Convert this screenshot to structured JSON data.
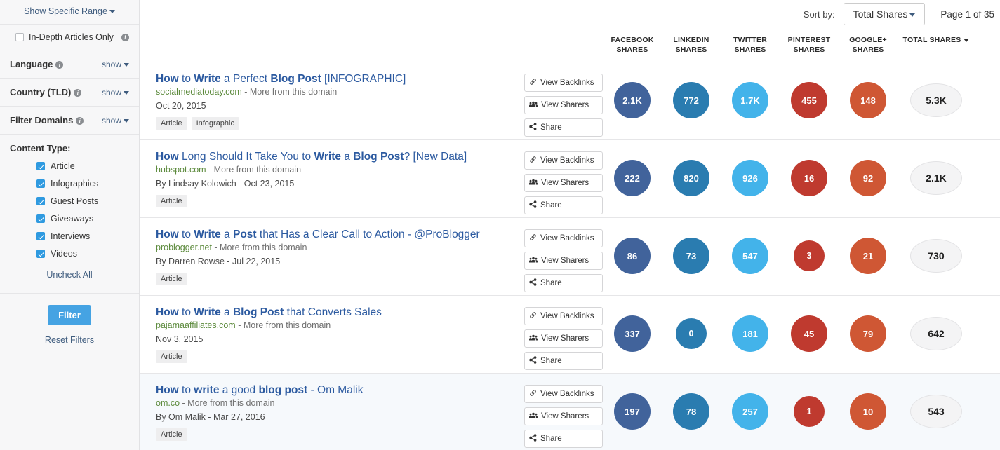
{
  "sidebar": {
    "show_specific_range": "Show Specific Range",
    "in_depth": {
      "label": "In-Depth Articles Only",
      "checked": false
    },
    "sections": [
      {
        "title": "Language",
        "show": "show"
      },
      {
        "title": "Country (TLD)",
        "show": "show"
      },
      {
        "title": "Filter Domains",
        "show": "show"
      }
    ],
    "content_type": {
      "title": "Content Type:",
      "items": [
        {
          "label": "Article",
          "checked": true
        },
        {
          "label": "Infographics",
          "checked": true
        },
        {
          "label": "Guest Posts",
          "checked": true
        },
        {
          "label": "Giveaways",
          "checked": true
        },
        {
          "label": "Interviews",
          "checked": true
        },
        {
          "label": "Videos",
          "checked": true
        }
      ],
      "uncheck_all": "Uncheck All"
    },
    "filter_button": "Filter",
    "reset_filters": "Reset Filters"
  },
  "toolbar": {
    "sort_by_label": "Sort by:",
    "sort_value": "Total Shares",
    "page_status": "Page 1 of 35"
  },
  "columns": [
    {
      "line1": "FACEBOOK",
      "line2": "SHARES",
      "key": "facebook"
    },
    {
      "line1": "LINKEDIN",
      "line2": "SHARES",
      "key": "linkedin"
    },
    {
      "line1": "TWITTER",
      "line2": "SHARES",
      "key": "twitter"
    },
    {
      "line1": "PINTEREST",
      "line2": "SHARES",
      "key": "pinterest"
    },
    {
      "line1": "GOOGLE+",
      "line2": "SHARES",
      "key": "googleplus"
    },
    {
      "line1": "TOTAL SHARES",
      "line2": "",
      "key": "total",
      "sorted": true
    }
  ],
  "row_buttons": [
    {
      "label": "View Backlinks",
      "icon": "link-icon"
    },
    {
      "label": "View Sharers",
      "icon": "people-icon"
    },
    {
      "label": "Share",
      "icon": "share-icon"
    }
  ],
  "colors": {
    "facebook": "#41639b",
    "linkedin": "#2a7cb0",
    "twitter": "#43b3ea",
    "pinterest": "#bf3a2f",
    "googleplus": "#cf5734",
    "total_bg": "#f4f4f5",
    "accent": "#45a3e3",
    "link": "#2c5aa0",
    "domain": "#5c8a3c"
  },
  "results": [
    {
      "title_parts": [
        {
          "t": "How",
          "b": true
        },
        {
          "t": " to ",
          "b": false
        },
        {
          "t": "Write",
          "b": true
        },
        {
          "t": " a Perfect ",
          "b": false
        },
        {
          "t": "Blog Post",
          "b": true
        },
        {
          "t": " [INFOGRAPHIC]",
          "b": false
        }
      ],
      "domain": "socialmediatoday.com",
      "more_from": " - More from this domain",
      "meta": "Oct 20, 2015",
      "tags": [
        "Article",
        "Infographic"
      ],
      "facebook": "2.1K",
      "linkedin": "772",
      "twitter": "1.7K",
      "pinterest": "455",
      "googleplus": "148",
      "total": "5.3K",
      "highlight": false
    },
    {
      "title_parts": [
        {
          "t": "How",
          "b": true
        },
        {
          "t": " Long Should It Take You to ",
          "b": false
        },
        {
          "t": "Write",
          "b": true
        },
        {
          "t": " a ",
          "b": false
        },
        {
          "t": "Blog Post",
          "b": true
        },
        {
          "t": "? [New Data]",
          "b": false
        }
      ],
      "domain": "hubspot.com",
      "more_from": " - More from this domain",
      "meta": "By Lindsay Kolowich - Oct 23, 2015",
      "tags": [
        "Article"
      ],
      "facebook": "222",
      "linkedin": "820",
      "twitter": "926",
      "pinterest": "16",
      "googleplus": "92",
      "total": "2.1K",
      "highlight": false
    },
    {
      "title_parts": [
        {
          "t": "How",
          "b": true
        },
        {
          "t": " to ",
          "b": false
        },
        {
          "t": "Write",
          "b": true
        },
        {
          "t": " a ",
          "b": false
        },
        {
          "t": "Post",
          "b": true
        },
        {
          "t": " that Has a Clear Call to Action - @ProBlogger",
          "b": false
        }
      ],
      "domain": "problogger.net",
      "more_from": " - More from this domain",
      "meta": "By Darren Rowse - Jul 22, 2015",
      "tags": [
        "Article"
      ],
      "facebook": "86",
      "linkedin": "73",
      "twitter": "547",
      "pinterest": "3",
      "googleplus": "21",
      "total": "730",
      "highlight": false
    },
    {
      "title_parts": [
        {
          "t": "How",
          "b": true
        },
        {
          "t": " to ",
          "b": false
        },
        {
          "t": "Write",
          "b": true
        },
        {
          "t": " a ",
          "b": false
        },
        {
          "t": "Blog Post",
          "b": true
        },
        {
          "t": " that Converts Sales",
          "b": false
        }
      ],
      "domain": "pajamaaffiliates.com",
      "more_from": " - More from this domain",
      "meta": "Nov 3, 2015",
      "tags": [
        "Article"
      ],
      "facebook": "337",
      "linkedin": "0",
      "twitter": "181",
      "pinterest": "45",
      "googleplus": "79",
      "total": "642",
      "highlight": false
    },
    {
      "title_parts": [
        {
          "t": "How",
          "b": true
        },
        {
          "t": " to ",
          "b": false
        },
        {
          "t": "write",
          "b": true
        },
        {
          "t": " a good ",
          "b": false
        },
        {
          "t": "blog post",
          "b": true
        },
        {
          "t": "  - Om Malik",
          "b": false
        }
      ],
      "domain": "om.co",
      "more_from": " - More from this domain",
      "meta": "By Om Malik - Mar 27, 2016",
      "tags": [
        "Article"
      ],
      "facebook": "197",
      "linkedin": "78",
      "twitter": "257",
      "pinterest": "1",
      "googleplus": "10",
      "total": "543",
      "highlight": true
    }
  ]
}
